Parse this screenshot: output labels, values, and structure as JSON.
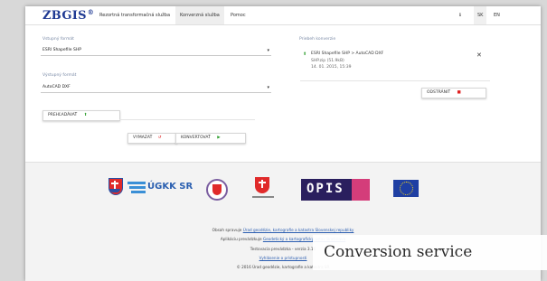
{
  "header": {
    "logo": "ZBGIS",
    "logo_mark": "®",
    "nav": [
      "Rezortná transformačná služba",
      "Konverzná služba",
      "Pomoc"
    ],
    "langs": [
      "SK",
      "EN"
    ],
    "info_icon": "info-icon"
  },
  "form": {
    "input_format_label": "Vstupný formát",
    "input_format_value": "ESRI Shapefile SHP",
    "output_format_label": "Výstupný formát",
    "output_format_value": "AutoCAD DXF",
    "upload_label": "PREHĽADÁVAŤ",
    "clear_label": "VYMAZAŤ",
    "convert_label": "KONVERTOVAŤ"
  },
  "history": {
    "title": "Priebeh konverzie",
    "item_title": "ESRI Shapefile SHP > AutoCAD DXF",
    "item_file": "SHP.zip (51.9kB)",
    "item_date": "14. 01. 2015, 15:39",
    "remove_label": "ODSTRÁNIŤ"
  },
  "footer": {
    "logos": [
      "slovak-coat-of-arms",
      "ugkk-sr",
      "ministry-seal",
      "ministry-crest",
      "opis",
      "eu-flag"
    ],
    "ugkk_label": "ÚGKK SR",
    "opis_label": "OPIS",
    "line1_prefix": "Obsah spravuje",
    "line1_link": "Úrad geodézie, kartografie a katastra Slovenskej republiky",
    "line2_prefix": "Aplikáciu prevádzkuje",
    "line2_link": "Geodetický a kartografický ústav Bratislava",
    "version": "Testovacia prevádzka - verzia 3.16",
    "contact": "Vyhlásenie o prístupnosti",
    "copyright": "© 2016 Úrad geodézie, kartografie a katastra SR"
  },
  "caption": "Conversion service",
  "colors": {
    "brand": "#1f3a93",
    "accent_green": "#2e9e2e",
    "accent_red": "#e02020",
    "link": "#2a5db0"
  }
}
